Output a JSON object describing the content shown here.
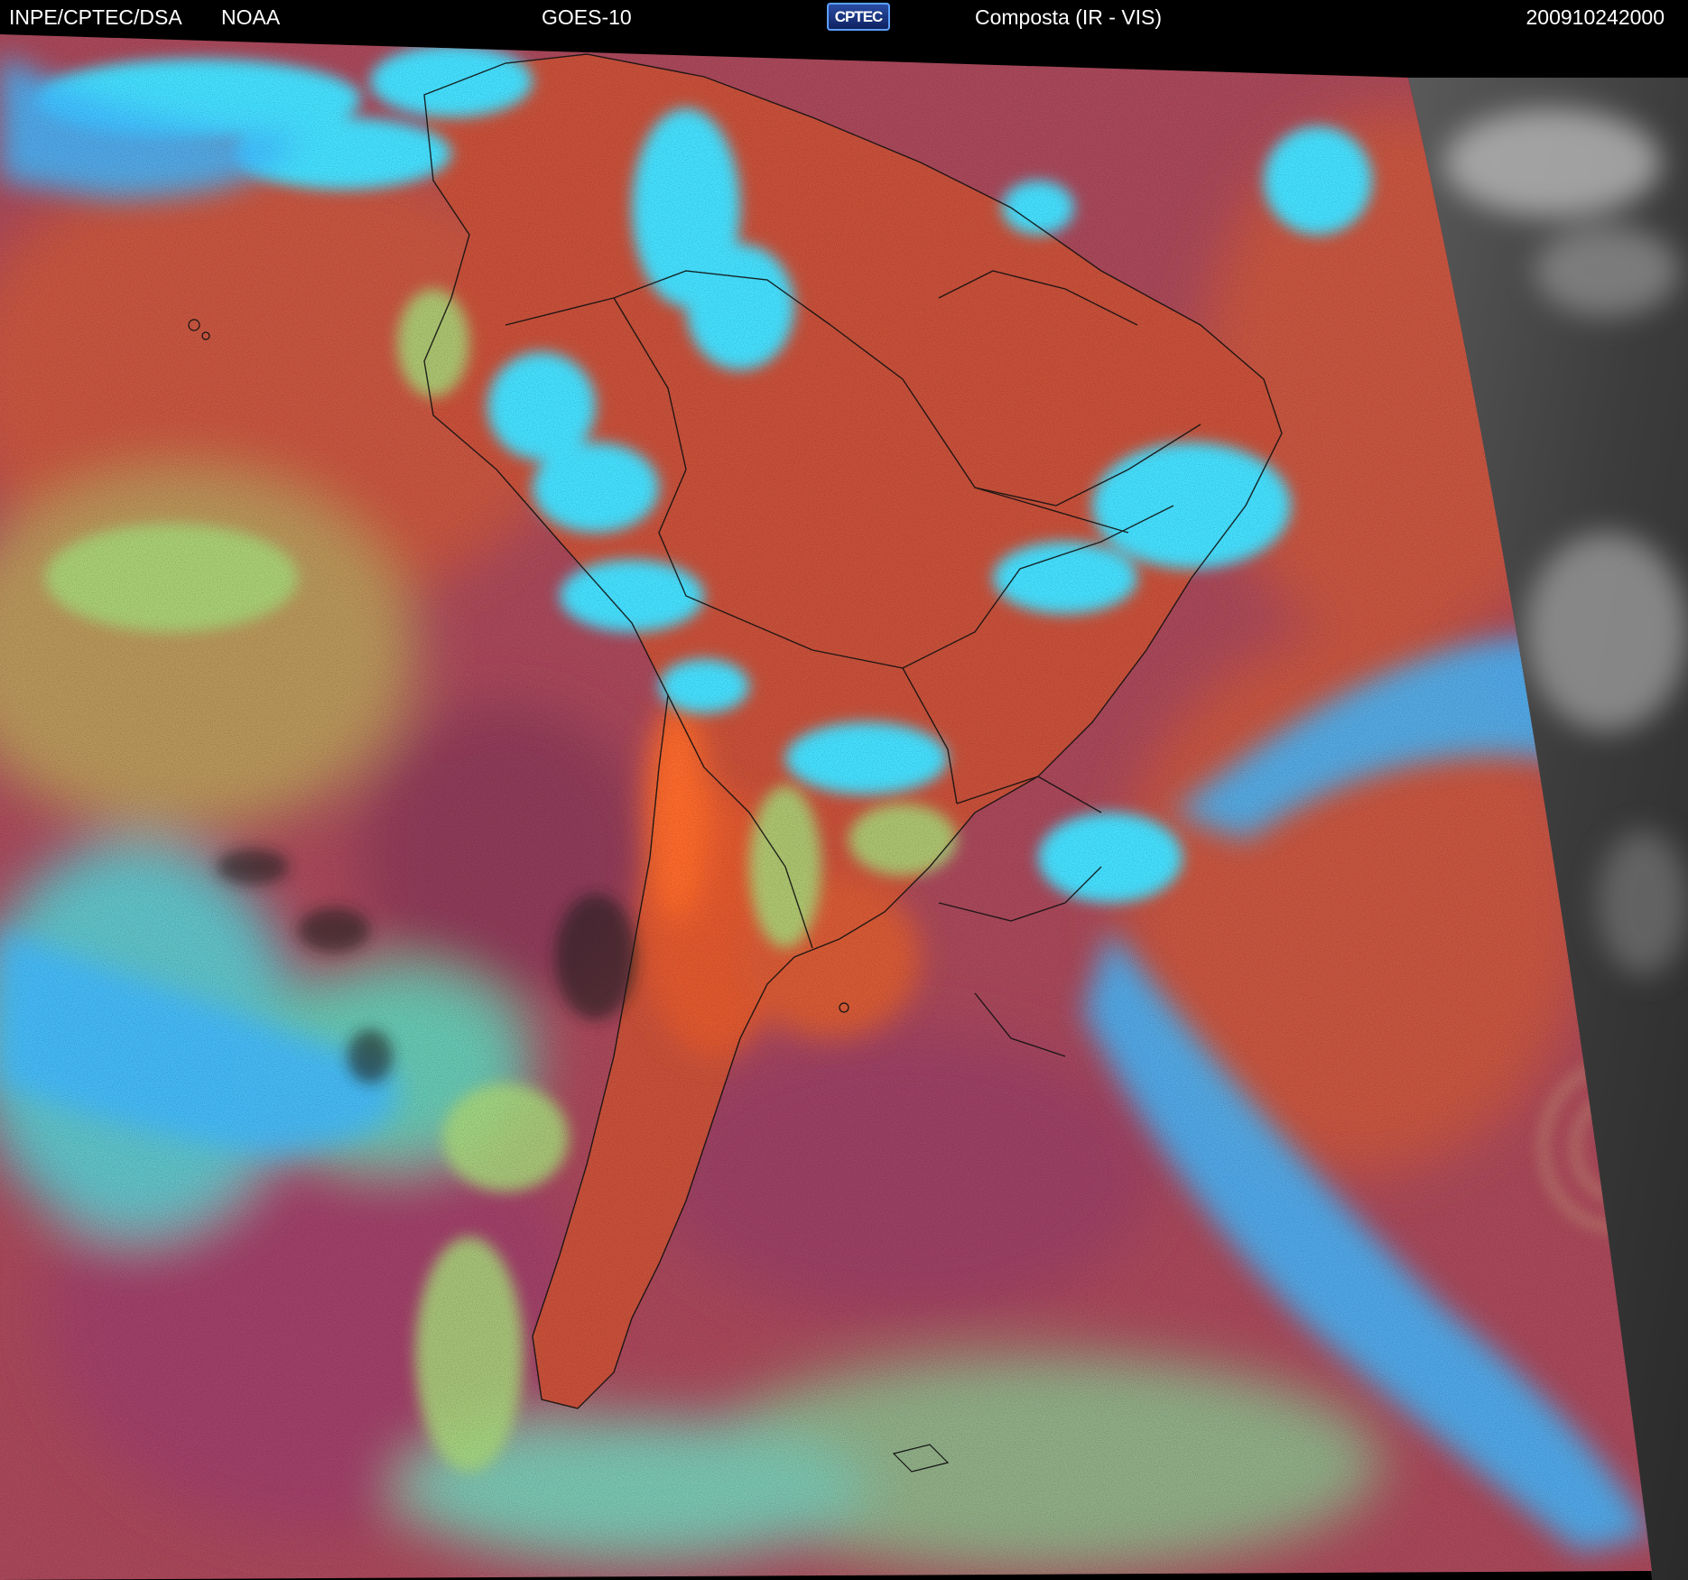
{
  "header": {
    "organization": "INPE/CPTEC/DSA",
    "agency": "NOAA",
    "satellite": "GOES-10",
    "logo_text": "CPTEC",
    "product": "Composta (IR - VIS)",
    "timestamp": "200910242000"
  },
  "colors": {
    "background": "#000000",
    "header_text": "#ffffff",
    "land_clear": "#c4503a",
    "ocean_clear": "#a04a5a",
    "high_cloud": "#3fe4ff",
    "mid_cloud": "#4aa0e8",
    "low_cloud": "#9fcf7a",
    "visible_only_grey": "#4a4a4a"
  }
}
